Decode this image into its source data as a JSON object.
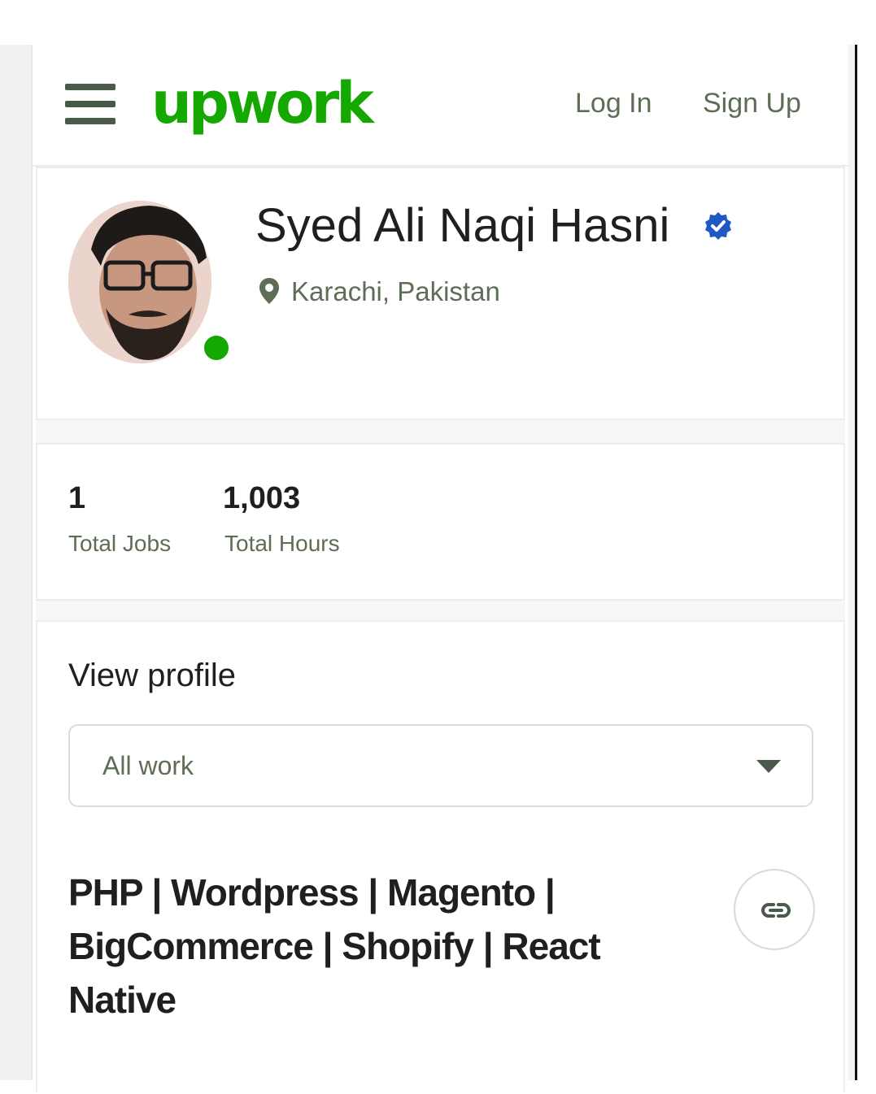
{
  "header": {
    "brand": "upwork",
    "login_label": "Log In",
    "signup_label": "Sign Up",
    "menu_icon": "hamburger-menu-icon"
  },
  "profile": {
    "name": "Syed Ali Naqi Hasni",
    "verified_icon": "verified-badge-icon",
    "location_icon": "location-pin-icon",
    "location": "Karachi, Pakistan",
    "online": true
  },
  "stats": [
    {
      "value": "1",
      "label": "Total Jobs"
    },
    {
      "value": "1,003",
      "label": "Total Hours"
    }
  ],
  "view_profile": {
    "title": "View profile",
    "select_value": "All work",
    "job_title": "PHP | Wordpress | Magento | BigCommerce | Shopify | React Native",
    "link_icon": "link-icon"
  },
  "colors": {
    "brand_green": "#14a800",
    "verified_blue": "#1f57c3",
    "muted_text": "#5e6d55"
  }
}
